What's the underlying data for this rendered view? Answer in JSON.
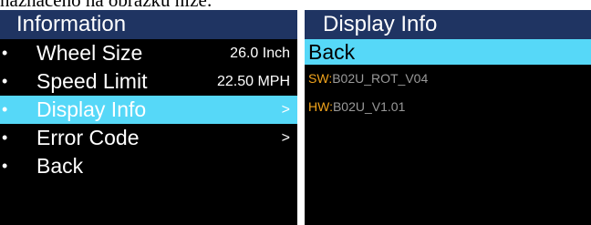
{
  "caption": "naznačeno na obrázku níže:",
  "left_screen": {
    "title": "Information",
    "items": [
      {
        "label": "Wheel Size",
        "value": "26.0 Inch",
        "bullet": "•",
        "selected": false
      },
      {
        "label": "Speed Limit",
        "value": "22.50 MPH",
        "bullet": "•",
        "selected": false
      },
      {
        "label": "Display Info",
        "value": ">",
        "bullet": "•",
        "selected": true
      },
      {
        "label": "Error Code",
        "value": ">",
        "bullet": "•",
        "selected": false
      },
      {
        "label": "Back",
        "value": "",
        "bullet": "•",
        "selected": false
      }
    ]
  },
  "right_screen": {
    "title": "Display Info",
    "back_label": "Back",
    "rows": [
      {
        "key": "SW",
        "separator": ":",
        "value": "B02U_ROT_V04"
      },
      {
        "key": "HW",
        "separator": ":",
        "value": "B02U_V1.01"
      }
    ]
  },
  "colors": {
    "title_bar": "#1f3462",
    "highlight": "#56d8f8",
    "screen_bg": "#000000",
    "info_key": "#f2a41c",
    "info_value": "#9a9a9a"
  }
}
